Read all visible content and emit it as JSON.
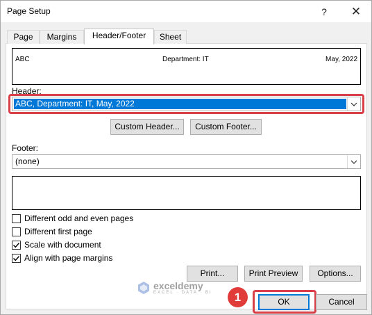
{
  "window": {
    "title": "Page Setup",
    "help_icon": "?",
    "close_icon": "✕"
  },
  "tabs": [
    {
      "label": "Page",
      "active": false
    },
    {
      "label": "Margins",
      "active": false
    },
    {
      "label": "Header/Footer",
      "active": true
    },
    {
      "label": "Sheet",
      "active": false
    }
  ],
  "preview": {
    "left": "ABC",
    "center": "Department: IT",
    "right": "May, 2022"
  },
  "header": {
    "label": "Header:",
    "value": "ABC, Department: IT, May, 2022"
  },
  "buttons": {
    "custom_header": "Custom Header...",
    "custom_footer": "Custom Footer...",
    "print": "Print...",
    "print_preview": "Print Preview",
    "options": "Options...",
    "ok": "OK",
    "cancel": "Cancel"
  },
  "footer": {
    "label": "Footer:",
    "value": "(none)"
  },
  "checkboxes": [
    {
      "label": "Different odd and even pages",
      "checked": false
    },
    {
      "label": "Different first page",
      "checked": false
    },
    {
      "label": "Scale with document",
      "checked": true
    },
    {
      "label": "Align with page margins",
      "checked": true
    }
  ],
  "watermark": {
    "name": "exceldemy",
    "tagline": "EXCEL · DATA · BI"
  },
  "step_badge": "1",
  "colors": {
    "highlight": "#d9404a",
    "selection": "#0078d7",
    "badge": "#e03c3a"
  }
}
